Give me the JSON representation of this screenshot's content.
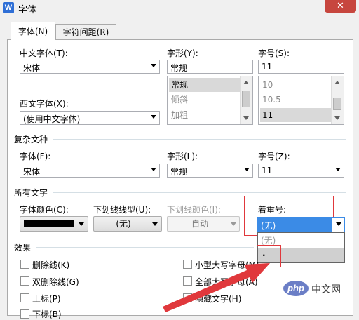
{
  "window": {
    "title": "字体",
    "app_icon": "W",
    "close_glyph": "✕"
  },
  "tabs": [
    {
      "label": "字体(N)",
      "active": true
    },
    {
      "label": "字符间距(R)",
      "active": false
    }
  ],
  "chinese_font": {
    "label": "中文字体(T):",
    "value": "宋体"
  },
  "style": {
    "label": "字形(Y):",
    "value": "常规",
    "options": [
      "常规",
      "倾斜",
      "加粗"
    ],
    "selected": "常规"
  },
  "size": {
    "label": "字号(S):",
    "value": "11",
    "options": [
      "10",
      "10.5",
      "11"
    ],
    "selected": "11"
  },
  "western_font": {
    "label": "西文字体(X):",
    "value": "(使用中文字体)"
  },
  "complex": {
    "heading": "复杂文种",
    "font_label": "字体(F):",
    "font_value": "宋体",
    "style_label": "字形(L):",
    "style_value": "常规",
    "size_label": "字号(Z):",
    "size_value": "11"
  },
  "all_text": {
    "heading": "所有文字",
    "color_label": "字体颜色(C):",
    "color_value": "#000000",
    "underline_label": "下划线线型(U):",
    "underline_value": "(无)",
    "underline_color_label": "下划线颜色(I):",
    "underline_color_value": "自动",
    "emphasis_label": "着重号:",
    "emphasis_value": "(无)",
    "emphasis_options": [
      "(无)",
      "."
    ]
  },
  "effects": {
    "heading": "效果",
    "items": [
      "删除线(K)",
      "双删除线(G)",
      "上标(P)",
      "下标(B)",
      "小型大写字母(M)",
      "全部大写字母(A)",
      "隐藏文字(H)"
    ]
  },
  "watermark": {
    "logo": "php",
    "site": "中文网"
  },
  "colors": {
    "highlight": "#e0383c",
    "selected_blue": "#3b8be6",
    "arrow_red": "#e0383c"
  }
}
